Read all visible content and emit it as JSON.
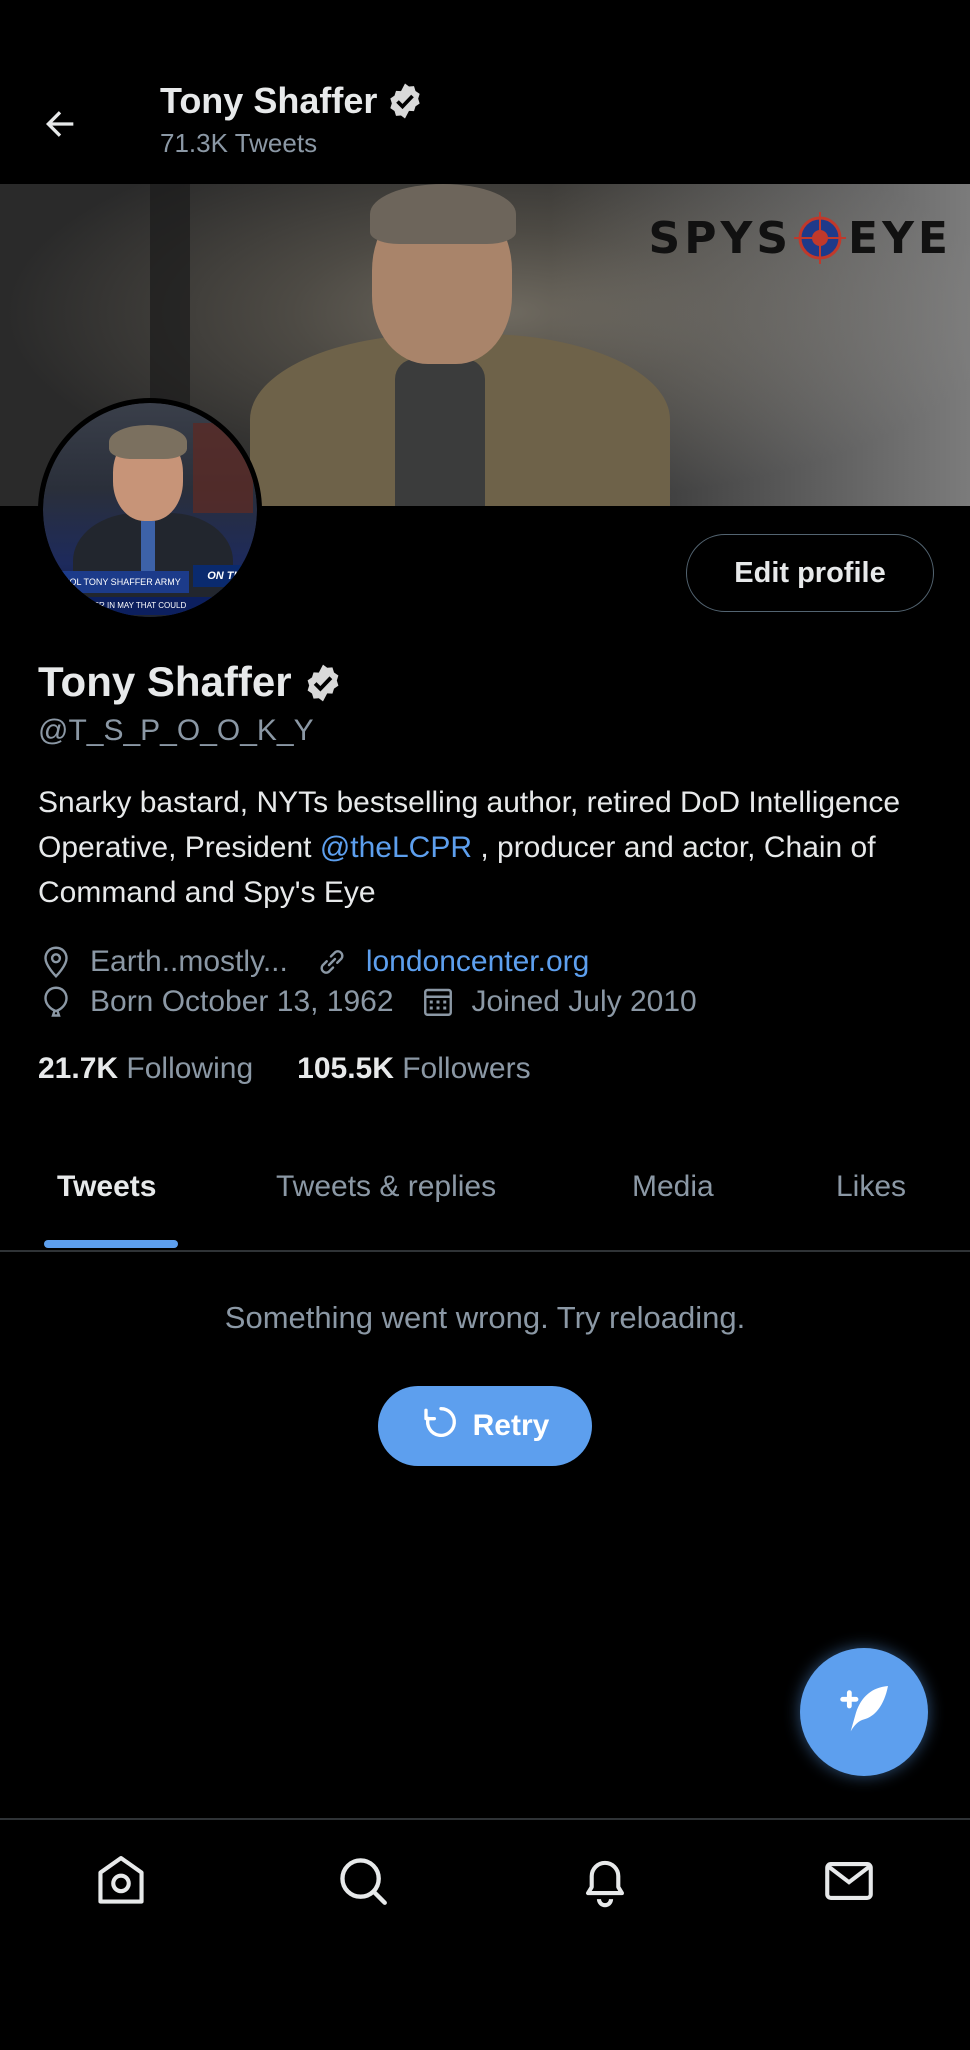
{
  "header": {
    "title": "Tony Shaffer",
    "tweet_count": "71.3K Tweets"
  },
  "banner": {
    "logo_left": "SPYS",
    "logo_right": "EYE"
  },
  "avatar": {
    "tag1": "COL TONY SHAFFER ARMY (RET)",
    "tag2": "ON THE",
    "tag3": "NTER IN MAY THAT COULD"
  },
  "profile": {
    "edit_label": "Edit profile",
    "name": "Tony Shaffer",
    "handle": "@T_S_P_O_O_K_Y",
    "bio_part1": "Snarky bastard, NYTs bestselling author, retired DoD Intelligence Operative, President ",
    "bio_link": "@theLCPR",
    "bio_part2": " , producer and actor, Chain of Command and Spy's Eye",
    "location": "Earth..mostly...",
    "website": "londoncenter.org",
    "born": "Born October 13, 1962",
    "joined": "Joined July 2010",
    "following_count": "21.7K",
    "following_label": "Following",
    "followers_count": "105.5K",
    "followers_label": "Followers"
  },
  "tabs": [
    {
      "label": "Tweets"
    },
    {
      "label": "Tweets & replies"
    },
    {
      "label": "Media"
    },
    {
      "label": "Likes"
    }
  ],
  "content": {
    "error_text": "Something went wrong. Try reloading.",
    "retry_label": "Retry"
  },
  "colors": {
    "accent": "#5d9fee",
    "background": "#000000",
    "muted_text": "#8b98a5"
  },
  "icons": [
    "back-arrow-icon",
    "verified-badge-icon",
    "location-icon",
    "link-icon",
    "birthday-balloon-icon",
    "calendar-icon",
    "refresh-icon",
    "compose-tweet-icon",
    "home-icon",
    "search-icon",
    "notifications-bell-icon",
    "messages-envelope-icon"
  ]
}
